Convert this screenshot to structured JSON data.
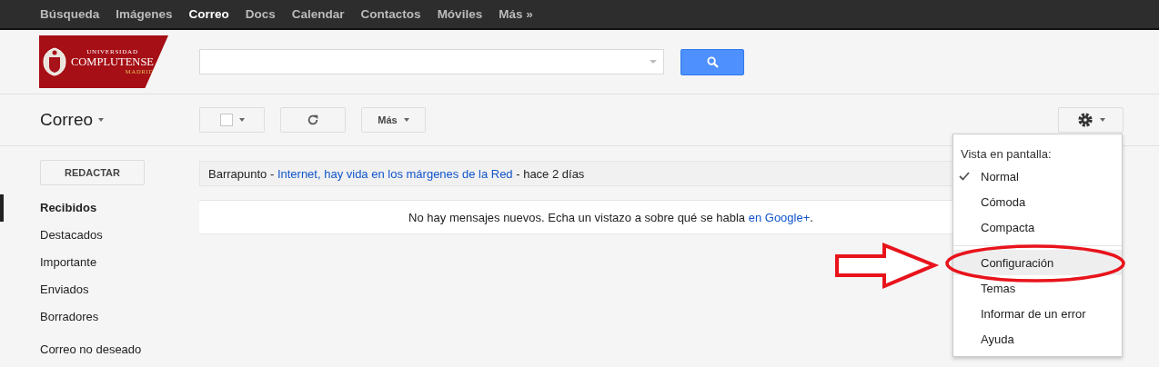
{
  "top_nav": [
    {
      "label": "Búsqueda",
      "selected": false
    },
    {
      "label": "Imágenes",
      "selected": false
    },
    {
      "label": "Correo",
      "selected": true
    },
    {
      "label": "Docs",
      "selected": false
    },
    {
      "label": "Calendar",
      "selected": false
    },
    {
      "label": "Contactos",
      "selected": false
    },
    {
      "label": "Móviles",
      "selected": false
    },
    {
      "label": "Más »",
      "selected": false
    }
  ],
  "logo": {
    "top": "UNIVERSIDAD",
    "name": "COMPLUTENSE",
    "city": "MADRID"
  },
  "app_title": "Correo",
  "toolbar": {
    "select_all": {
      "checked": false
    },
    "more_button": "Más"
  },
  "compose_button": "REDACTAR",
  "sidebar": {
    "items": [
      {
        "label": "Recibidos",
        "selected": true
      },
      {
        "label": "Destacados",
        "selected": false
      },
      {
        "label": "Importante",
        "selected": false
      },
      {
        "label": "Enviados",
        "selected": false
      },
      {
        "label": "Borradores",
        "selected": false
      },
      {
        "label": "Correo no deseado",
        "selected": false
      }
    ]
  },
  "web_clip": {
    "source": "Barrapunto -",
    "link": "Internet, hay vida en los márgenes de la Red",
    "age": "- hace 2 días"
  },
  "empty_message": {
    "text": "No hay mensajes nuevos. Echa un vistazo a sobre qué se habla",
    "link": "en Google+",
    "end": "."
  },
  "settings_menu": {
    "header": "Vista en pantalla:",
    "items": [
      {
        "kind": "density",
        "label": "Normal",
        "checked": true,
        "highlighted": false
      },
      {
        "kind": "density",
        "label": "Cómoda",
        "checked": false,
        "highlighted": false
      },
      {
        "kind": "density",
        "label": "Compacta",
        "checked": false,
        "highlighted": false
      },
      {
        "kind": "action",
        "label": "Configuración",
        "checked": false,
        "highlighted": true
      },
      {
        "kind": "action",
        "label": "Temas",
        "checked": false,
        "highlighted": false
      },
      {
        "kind": "action",
        "label": "Informar de un error",
        "checked": false,
        "highlighted": false
      },
      {
        "kind": "action",
        "label": "Ayuda",
        "checked": false,
        "highlighted": false
      }
    ]
  }
}
